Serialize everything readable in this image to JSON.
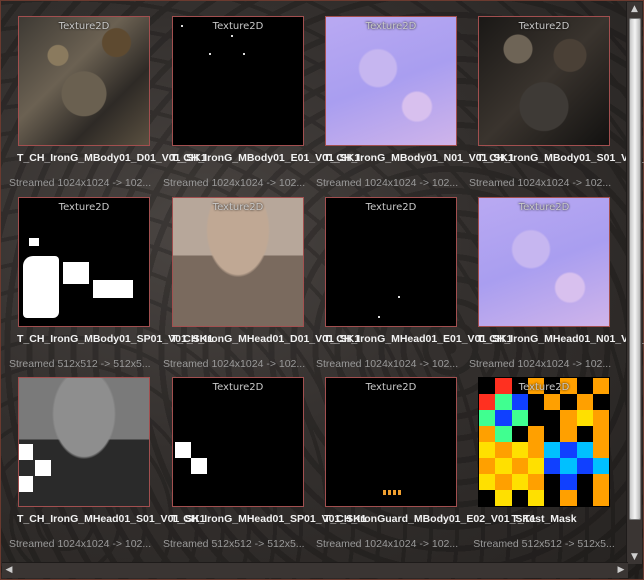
{
  "tiles": [
    {
      "kind": "Texture2D",
      "name": "T_CH_IronG_MBody01_D01_V01_SK1",
      "meta": "Streamed 1024x1024 -> 102..."
    },
    {
      "kind": "Texture2D",
      "name": "T_CH_IronG_MBody01_E01_V01_SK1",
      "meta": "Streamed 1024x1024 -> 102..."
    },
    {
      "kind": "Texture2D",
      "name": "T_CH_IronG_MBody01_N01_V01_SK1",
      "meta": "Streamed 1024x1024 -> 102..."
    },
    {
      "kind": "Texture2D",
      "name": "T_CH_IronG_MBody01_S01_V01_SK1",
      "meta": "Streamed 1024x1024 -> 102..."
    },
    {
      "kind": "Texture2D",
      "name": "T_CH_IronG_MBody01_SP01_V01_SK1",
      "meta": "Streamed 512x512 -> 512x5..."
    },
    {
      "kind": "Texture2D",
      "name": "T_CH_IronG_MHead01_D01_V01_SK1",
      "meta": "Streamed 1024x1024 -> 102..."
    },
    {
      "kind": "Texture2D",
      "name": "T_CH_IronG_MHead01_E01_V01_SK1",
      "meta": "Streamed 1024x1024 -> 102..."
    },
    {
      "kind": "Texture2D",
      "name": "T_CH_IronG_MHead01_N01_V01_SK1",
      "meta": "Streamed 1024x1024 -> 102..."
    },
    {
      "kind": "Texture2D",
      "name": "T_CH_IronG_MHead01_S01_V01_SK1",
      "meta": "Streamed 1024x1024 -> 102..."
    },
    {
      "kind": "Texture2D",
      "name": "T_CH_IronG_MHead01_SP01_V01_SK1",
      "meta": "Streamed 512x512 -> 512x5..."
    },
    {
      "kind": "Texture2D",
      "name": "T_CH_IronGuard_MBody01_E02_V01_SK1",
      "meta": "Streamed 1024x1024 -> 102..."
    },
    {
      "kind": "Texture2D",
      "name": "T_Test_Mask",
      "meta": "Streamed 512x512 -> 512x5..."
    }
  ],
  "colors": {
    "thumb_border": "#a24f4f",
    "name": "#f2f2f2",
    "meta": "#9a9a9a"
  },
  "scrollbar": {
    "up": "▲",
    "down": "▼",
    "left": "◀",
    "right": "▶"
  }
}
